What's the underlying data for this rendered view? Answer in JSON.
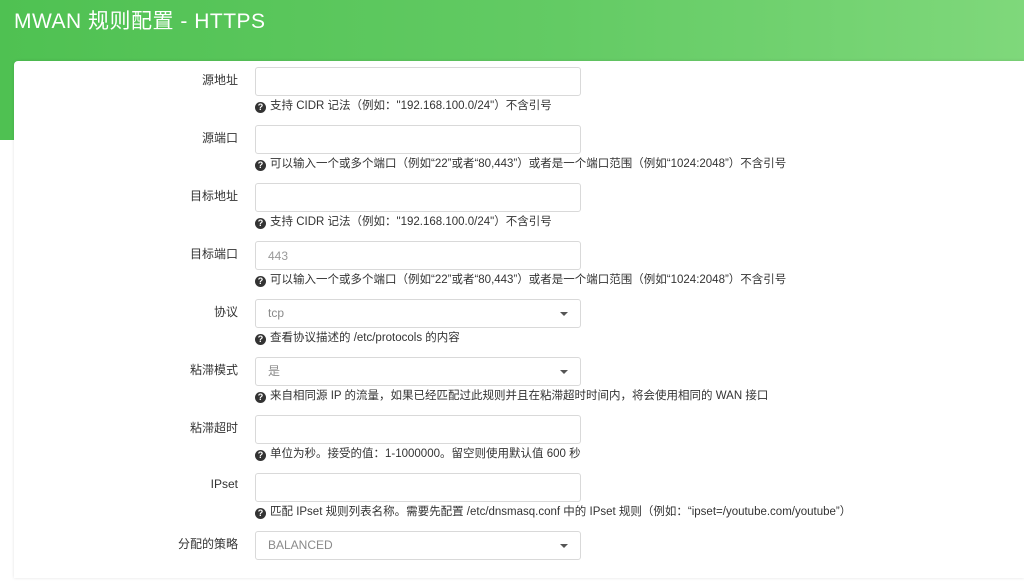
{
  "header": {
    "title": "MWAN 规则配置 - HTTPS"
  },
  "form": {
    "src_ip": {
      "label": "源地址",
      "value": "",
      "help": "支持 CIDR 记法（例如：\"192.168.100.0/24\"）不含引号"
    },
    "src_port": {
      "label": "源端口",
      "value": "",
      "help": "可以输入一个或多个端口（例如“22”或者“80,443”）或者是一个端口范围（例如“1024:2048”）不含引号"
    },
    "dest_ip": {
      "label": "目标地址",
      "value": "",
      "help": "支持 CIDR 记法（例如：\"192.168.100.0/24\"）不含引号"
    },
    "dest_port": {
      "label": "目标端口",
      "value": "443",
      "help": "可以输入一个或多个端口（例如“22”或者“80,443”）或者是一个端口范围（例如“1024:2048”）不含引号"
    },
    "proto": {
      "label": "协议",
      "value": "tcp",
      "help": "查看协议描述的 /etc/protocols 的内容"
    },
    "sticky": {
      "label": "粘滞模式",
      "value": "是",
      "help": "来自相同源 IP 的流量，如果已经匹配过此规则并且在粘滞超时时间内，将会使用相同的 WAN 接口"
    },
    "timeout": {
      "label": "粘滞超时",
      "value": "",
      "help": "单位为秒。接受的值：1-1000000。留空则使用默认值 600 秒"
    },
    "ipset": {
      "label": "IPset",
      "value": "",
      "help": "匹配 IPset 规则列表名称。需要先配置 /etc/dnsmasq.conf 中的 IPset 规则（例如：“ipset=/youtube.com/youtube”）"
    },
    "policy": {
      "label": "分配的策略",
      "value": "BALANCED"
    }
  },
  "icons": {
    "help": "question-circle-icon",
    "dropdown": "caret-down-icon"
  },
  "colors": {
    "header_gradient_start": "#4fc152",
    "header_gradient_end": "#7fd87b",
    "text": "#333333"
  }
}
